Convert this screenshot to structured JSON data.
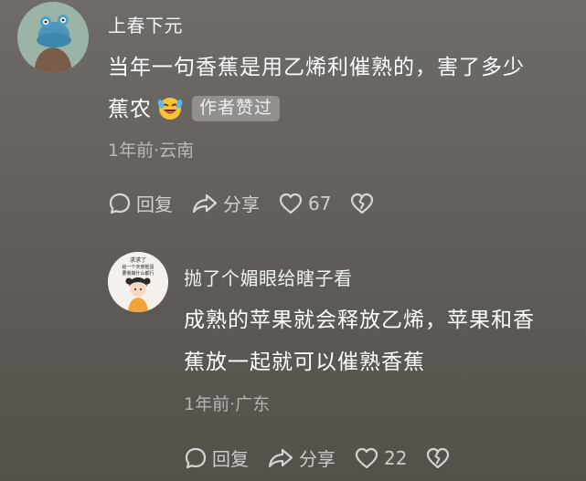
{
  "comments": [
    {
      "username": "上春下元",
      "text_line1": "当年一句香蕉是用乙烯利催熟的，害了多少",
      "text_line2": "蕉农",
      "emoji": "laughing-crying-emoji",
      "badge": "作者赞过",
      "meta": "1年前·云南",
      "reply_label": "回复",
      "share_label": "分享",
      "like_count": "67"
    },
    {
      "username": "抛了个媚眼给瞎子看",
      "text_line1": "成熟的苹果就会释放乙烯，苹果和香",
      "text_line2": "蕉放一起就可以催熟香蕉",
      "meta": "1年前·广东",
      "reply_label": "回复",
      "share_label": "分享",
      "like_count": "22",
      "avatar_caption_line1": "求求了",
      "avatar_caption_line2": "给一个天使脸蛋",
      "avatar_caption_line3": "要我做什么都行"
    }
  ],
  "colors": {
    "text": "#ffffff",
    "meta": "#bdbab6",
    "badge_bg": "#8f8c88"
  },
  "icons": [
    "comment-icon",
    "share-icon",
    "heart-icon",
    "broken-heart-icon"
  ]
}
